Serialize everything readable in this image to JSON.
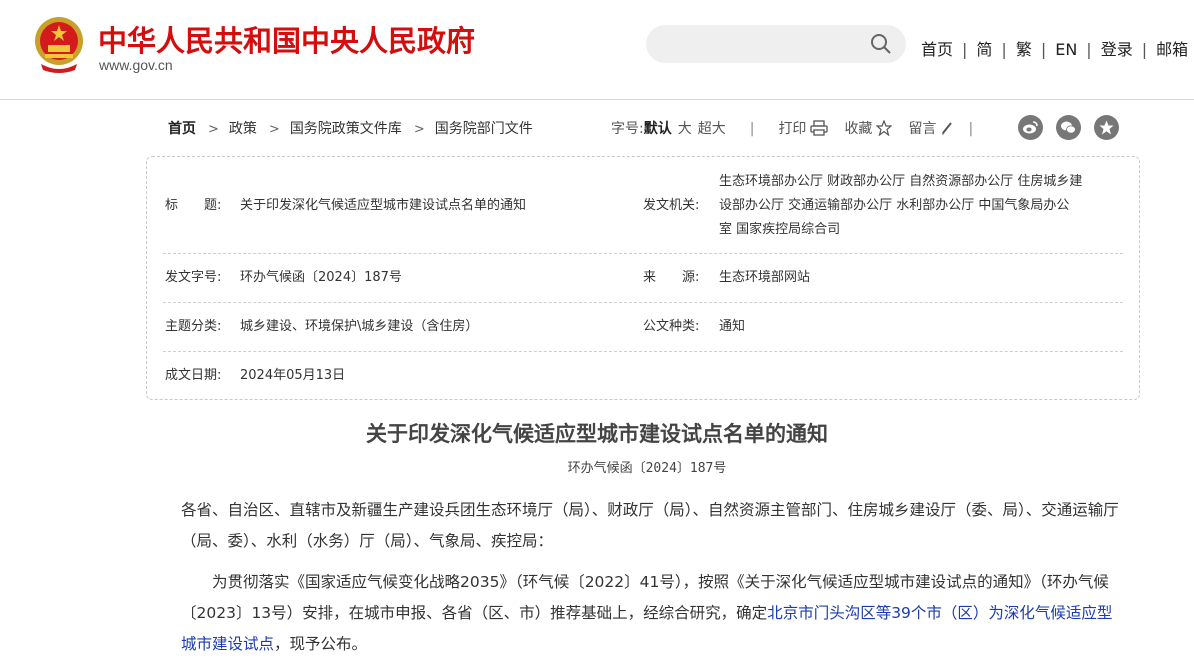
{
  "header": {
    "site_title": "中华人民共和国中央人民政府",
    "site_url": "www.gov.cn",
    "search_placeholder": "",
    "nav": [
      "首页",
      "简",
      "繁",
      "EN",
      "登录",
      "邮箱"
    ]
  },
  "breadcrumb": [
    "首页",
    "政策",
    "国务院政策文件库",
    "国务院部门文件"
  ],
  "tools": {
    "font_label": "字号:",
    "font_default": "默认",
    "font_large": "大",
    "font_xlarge": "超大",
    "print": "打印",
    "favorite": "收藏",
    "comment": "留言"
  },
  "share_icons": [
    "weibo-icon",
    "wechat-icon",
    "star-icon"
  ],
  "meta": {
    "title_label": "标　　题:",
    "title_value": "关于印发深化气候适应型城市建设试点名单的通知",
    "issuer_label": "发文机关:",
    "issuer_lines": [
      "生态环境部办公厅 财政部办公厅 自然资源部办公厅 住房城乡建",
      "设部办公厅 交通运输部办公厅 水利部办公厅 中国气象局办公",
      "室 国家疾控局综合司"
    ],
    "docno_label": "发文字号:",
    "docno_value": "环办气候函〔2024〕187号",
    "source_label": "来　　源:",
    "source_value": "生态环境部网站",
    "topic_label": "主题分类:",
    "topic_value": "城乡建设、环境保护\\城乡建设（含住房）",
    "type_label": "公文种类:",
    "type_value": "通知",
    "date_label": "成文日期:",
    "date_value": "2024年05月13日"
  },
  "article": {
    "title": "关于印发深化气候适应型城市建设试点名单的通知",
    "doc_no": "环办气候函〔2024〕187号",
    "para1": "各省、自治区、直辖市及新疆生产建设兵团生态环境厅（局）、财政厅（局）、自然资源主管部门、住房城乡建设厅（委、局）、交通运输厅（局、委）、水利（水务）厅（局）、气象局、疾控局：",
    "para2_before": "为贯彻落实《国家适应气候变化战略2035》（环气候〔2022〕41号），按照《关于深化气候适应型城市建设试点的通知》（环办气候〔2023〕13号）安排，在城市申报、各省（区、市）推荐基础上，经综合研究，确定",
    "para2_link": "北京市门头沟区等39个市（区）为深化气候适应型城市建设试点",
    "para2_after": "，现予公布。"
  },
  "colors": {
    "brand_red": "#d40d0d",
    "link_blue": "#1a3cb0"
  }
}
